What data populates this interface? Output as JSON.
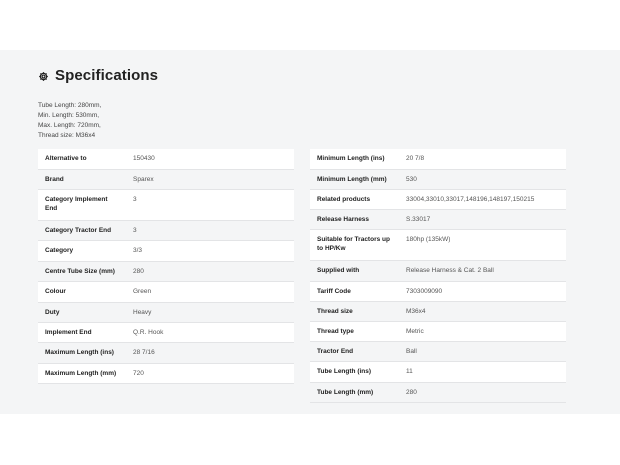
{
  "section": {
    "title": "Specifications",
    "icon": "gear-icon"
  },
  "summary": [
    "Tube Length: 280mm,",
    "Min. Length: 530mm,",
    "Max. Length: 720mm,",
    "Thread size: M36x4"
  ],
  "left_table": [
    {
      "label": "Alternative to",
      "value": "150430"
    },
    {
      "label": "Brand",
      "value": "Sparex"
    },
    {
      "label": "Category Implement End",
      "value": "3"
    },
    {
      "label": "Category Tractor End",
      "value": "3"
    },
    {
      "label": "Category",
      "value": "3/3"
    },
    {
      "label": "Centre Tube Size (mm)",
      "value": "280"
    },
    {
      "label": "Colour",
      "value": "Green"
    },
    {
      "label": "Duty",
      "value": "Heavy"
    },
    {
      "label": "Implement End",
      "value": "Q.R. Hook"
    },
    {
      "label": "Maximum Length (ins)",
      "value": "28 7/16"
    },
    {
      "label": "Maximum Length (mm)",
      "value": "720"
    }
  ],
  "right_table": [
    {
      "label": "Minimum Length (ins)",
      "value": "20 7/8"
    },
    {
      "label": "Minimum Length (mm)",
      "value": "530"
    },
    {
      "label": "Related products",
      "value": "33004,33010,33017,148196,148197,150215"
    },
    {
      "label": "Release Harness",
      "value": "S.33017"
    },
    {
      "label": "Suitable for Tractors up to HP/Kw",
      "value": "180hp (135kW)"
    },
    {
      "label": "Supplied with",
      "value": "Release Harness & Cat. 2 Ball"
    },
    {
      "label": "Tariff Code",
      "value": "7303009090"
    },
    {
      "label": "Thread size",
      "value": "M36x4"
    },
    {
      "label": "Thread type",
      "value": "Metric"
    },
    {
      "label": "Tractor End",
      "value": "Ball"
    },
    {
      "label": "Tube Length (ins)",
      "value": "11"
    },
    {
      "label": "Tube Length (mm)",
      "value": "280"
    }
  ]
}
